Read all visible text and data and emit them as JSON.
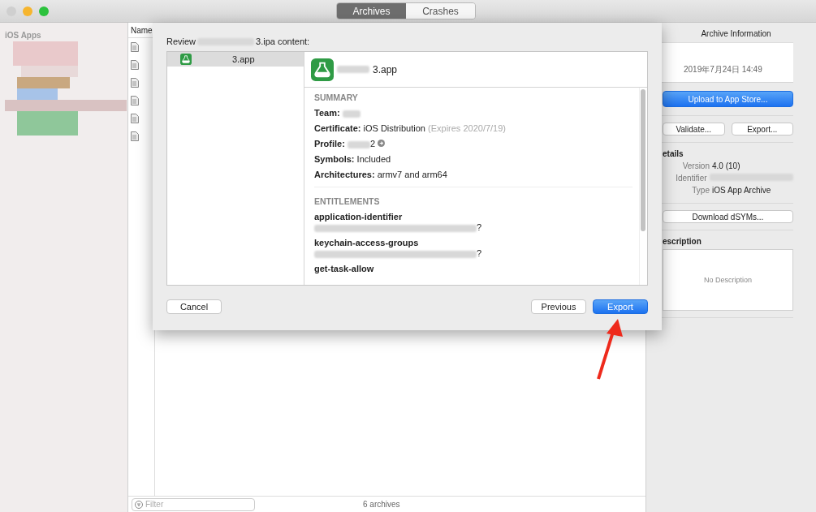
{
  "tabs": [
    {
      "label": "Archives",
      "selected": true
    },
    {
      "label": "Crashes",
      "selected": false
    }
  ],
  "sidebar": {
    "title": "iOS Apps"
  },
  "list": {
    "column": "Name",
    "rows": [
      {
        "kind": "archive"
      },
      {
        "kind": "archive"
      },
      {
        "kind": "archive"
      },
      {
        "kind": "archive"
      },
      {
        "kind": "archive"
      },
      {
        "kind": "archive"
      }
    ]
  },
  "footer": {
    "filter_placeholder": "Filter",
    "count": "6 archives"
  },
  "info_panel": {
    "title": "Archive Information",
    "date": "2019年7月24日 14:49",
    "upload_button": "Upload to App Store...",
    "validate_button": "Validate...",
    "export_button": "Export...",
    "details_heading": "etails",
    "details": [
      {
        "label": "Version",
        "value": "4.0 (10)"
      },
      {
        "label": "Identifier"
      },
      {
        "label": "Type",
        "value": "iOS App Archive"
      }
    ],
    "dsym_button": "Download dSYMs...",
    "description_heading": "escription",
    "description_placeholder": "No Description"
  },
  "dialog": {
    "title_prefix": "Review",
    "title_suffix": "3.ipa content:",
    "apps": [
      {
        "name": "3.app",
        "selected": true
      }
    ],
    "header_name": "3.app",
    "summary_heading": "SUMMARY",
    "summary": [
      {
        "label": "Team:"
      },
      {
        "label": "Certificate:",
        "value": "iOS Distribution",
        "note": "(Expires 2020/7/19)"
      },
      {
        "label": "Profile:",
        "value": "2",
        "link": true
      },
      {
        "label": "Symbols:",
        "value": "Included"
      },
      {
        "label": "Architectures:",
        "value": "armv7 and arm64"
      }
    ],
    "entitlements_heading": "ENTITLEMENTS",
    "entitlements": [
      {
        "key": "application-identifier",
        "value_tail": "?"
      },
      {
        "key": "keychain-access-groups",
        "value_tail": "?"
      },
      {
        "key": "get-task-allow"
      }
    ],
    "buttons": [
      {
        "label": "Cancel",
        "kind": "secondary"
      },
      {
        "label": "Previous",
        "kind": "secondary"
      },
      {
        "label": "Export",
        "kind": "primary"
      }
    ]
  }
}
